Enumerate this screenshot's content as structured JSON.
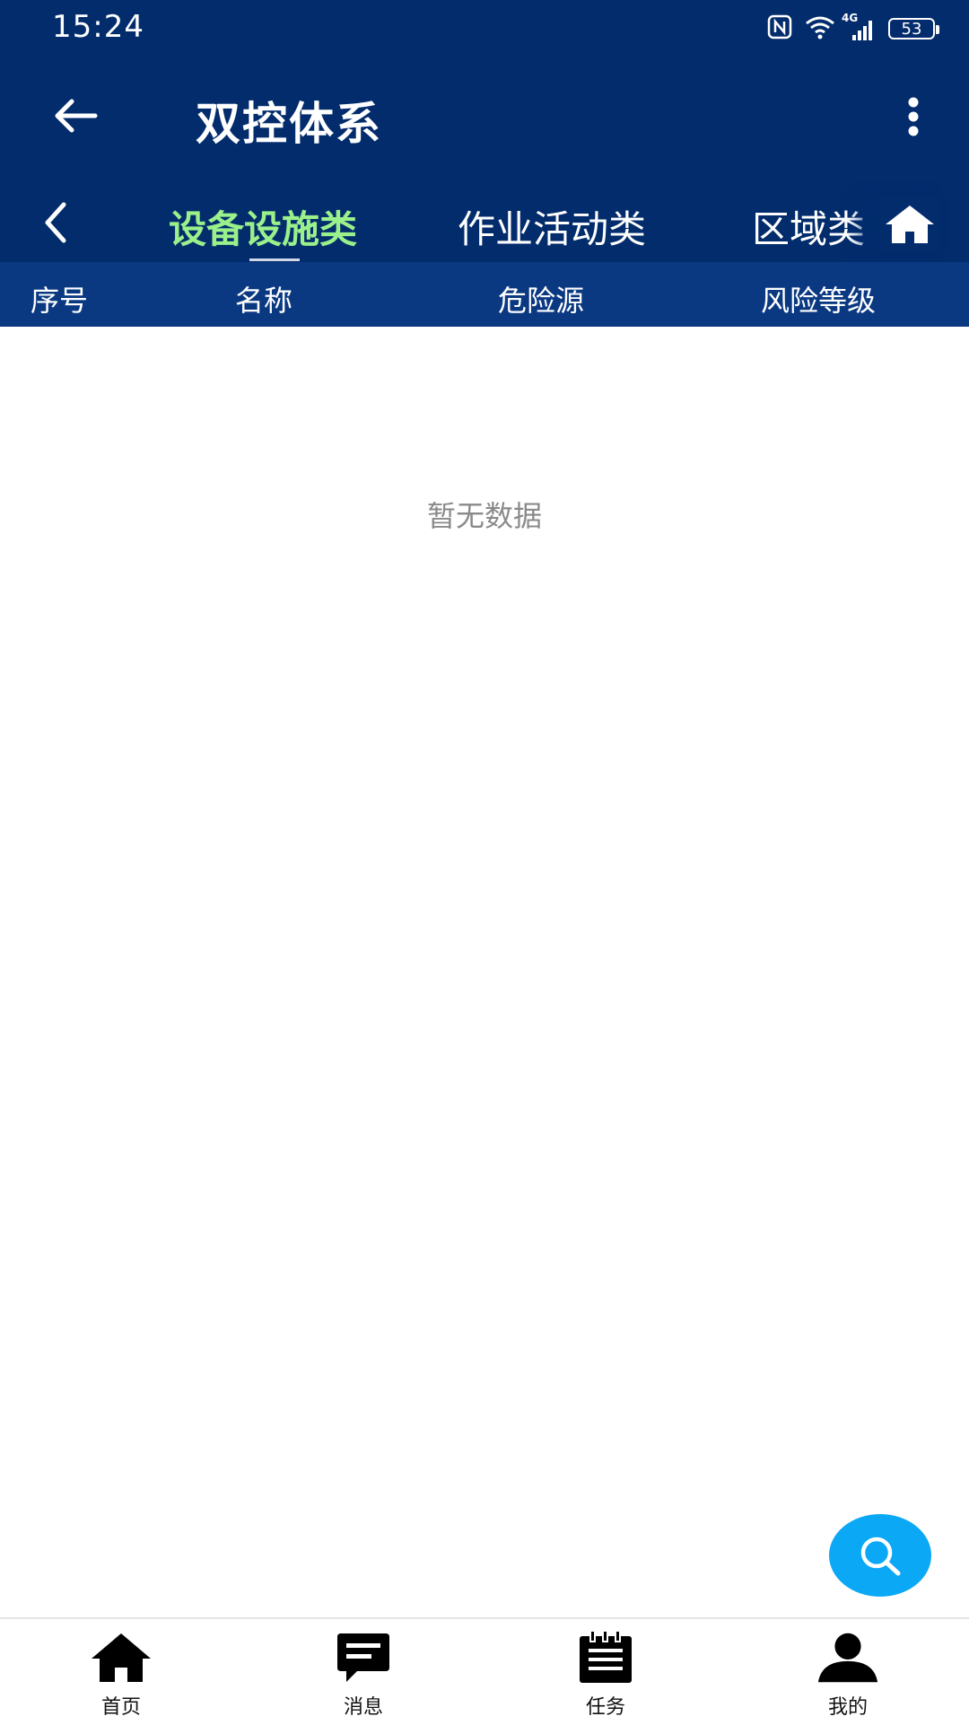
{
  "status_bar": {
    "time": "15:24",
    "network": "4G",
    "battery": "53",
    "icons": [
      "nfc-icon",
      "wifi-icon",
      "signal-icon",
      "battery-icon"
    ]
  },
  "app_bar": {
    "title": "双控体系",
    "back_icon": "arrow-left-icon",
    "more_icon": "more-vertical-icon"
  },
  "tabs": {
    "items": [
      {
        "label": "设备设施类",
        "active": true
      },
      {
        "label": "作业活动类",
        "active": false
      },
      {
        "label": "区域类",
        "active": false
      }
    ],
    "active_color": "#9af08a"
  },
  "table": {
    "columns": [
      "序号",
      "名称",
      "危险源",
      "风险等级"
    ],
    "empty_text": "暂无数据"
  },
  "bottom_nav": {
    "items": [
      {
        "label": "首页",
        "icon": "home-icon"
      },
      {
        "label": "消息",
        "icon": "message-icon"
      },
      {
        "label": "任务",
        "icon": "task-icon"
      },
      {
        "label": "我的",
        "icon": "user-icon"
      }
    ]
  },
  "colors": {
    "header_bg": "#022c6c",
    "table_header_bg": "#0a3982",
    "fab": "#0aa8f5"
  }
}
